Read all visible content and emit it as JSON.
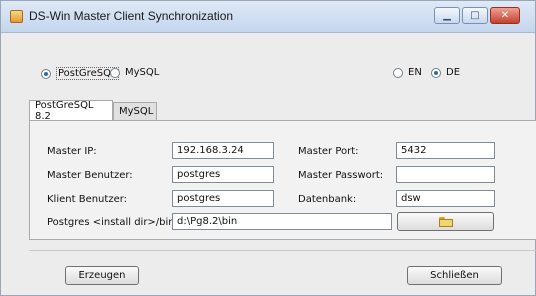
{
  "window": {
    "title": "DS-Win Master Client Synchronization"
  },
  "database_choice": {
    "postgresql": "PostGreSQL",
    "mysql": "MySQL",
    "selected": "PostGreSQL"
  },
  "language_choice": {
    "en": "EN",
    "de": "DE",
    "selected": "DE"
  },
  "tabs": [
    {
      "label": "PostGreSQL 8.2",
      "active": true
    },
    {
      "label": "MySQL",
      "active": false
    }
  ],
  "form": {
    "master_ip": {
      "label": "Master IP:",
      "value": "192.168.3.24"
    },
    "master_port": {
      "label": "Master Port:",
      "value": "5432"
    },
    "master_user": {
      "label": "Master Benutzer:",
      "value": "postgres"
    },
    "master_password": {
      "label": "Master Passwort:",
      "value": ""
    },
    "client_user": {
      "label": "Klient Benutzer:",
      "value": "postgres"
    },
    "database": {
      "label": "Datenbank:",
      "value": "dsw"
    },
    "install_dir": {
      "label": "Postgres <install dir>/bin:",
      "value": "d:\\Pg8.2\\bin"
    }
  },
  "buttons": {
    "generate": "Erzeugen",
    "close": "Schließen"
  },
  "icons": {
    "browse": "folder-open-icon",
    "app": "app-icon"
  }
}
